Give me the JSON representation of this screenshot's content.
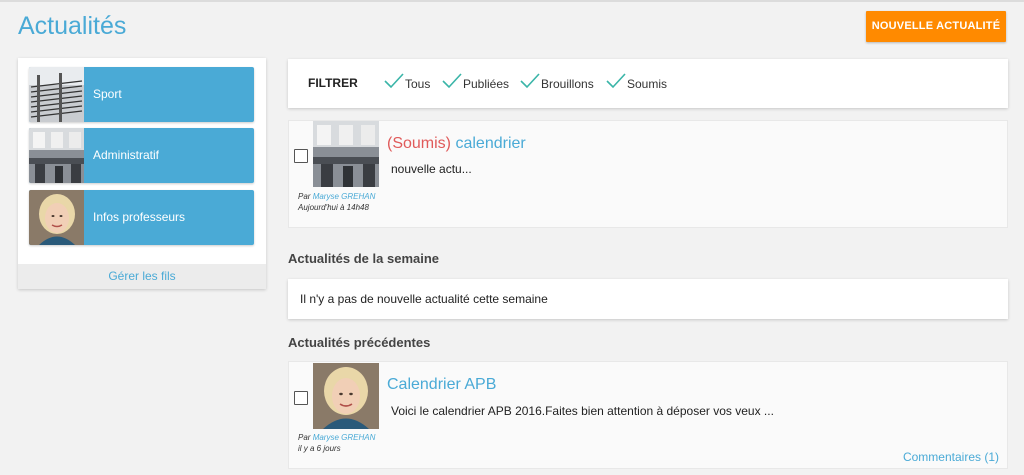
{
  "header": {
    "title": "Actualités",
    "new_button_label": "NOUVELLE ACTUALITÉ"
  },
  "sidebar": {
    "threads": [
      {
        "label": "Sport",
        "thumb": "building-photo"
      },
      {
        "label": "Administratif",
        "thumb": "office-photo"
      },
      {
        "label": "Infos professeurs",
        "thumb": "portrait-photo"
      }
    ],
    "manage_label": "Gérer les fils"
  },
  "filters": {
    "title": "FILTRER",
    "options": [
      {
        "label": "Tous",
        "checked": true
      },
      {
        "label": "Publiées",
        "checked": true
      },
      {
        "label": "Brouillons",
        "checked": true
      },
      {
        "label": "Soumis",
        "checked": true
      }
    ],
    "check_color": "#3ab5a8"
  },
  "pending": {
    "status": "(Soumis)",
    "title": "calendrier",
    "excerpt": "nouvelle actu...",
    "by_prefix": "Par",
    "author": "Maryse GREHAN",
    "date": "Aujourd'hui à 14h48"
  },
  "week_section": {
    "heading": "Actualités de la semaine",
    "empty_text": "Il n'y a pas de nouvelle actualité cette semaine"
  },
  "previous_section": {
    "heading": "Actualités précédentes",
    "items": [
      {
        "title": "Calendrier APB",
        "excerpt": "Voici le calendrier APB 2016.Faites bien attention à déposer vos veux ...",
        "by_prefix": "Par",
        "author": "Maryse GREHAN",
        "date": "il y a 6 jours",
        "comments": "Commentaires (1)"
      }
    ]
  },
  "colors": {
    "accent": "#4aaad6",
    "button": "#ff8a00",
    "status": "#e05a5a"
  }
}
